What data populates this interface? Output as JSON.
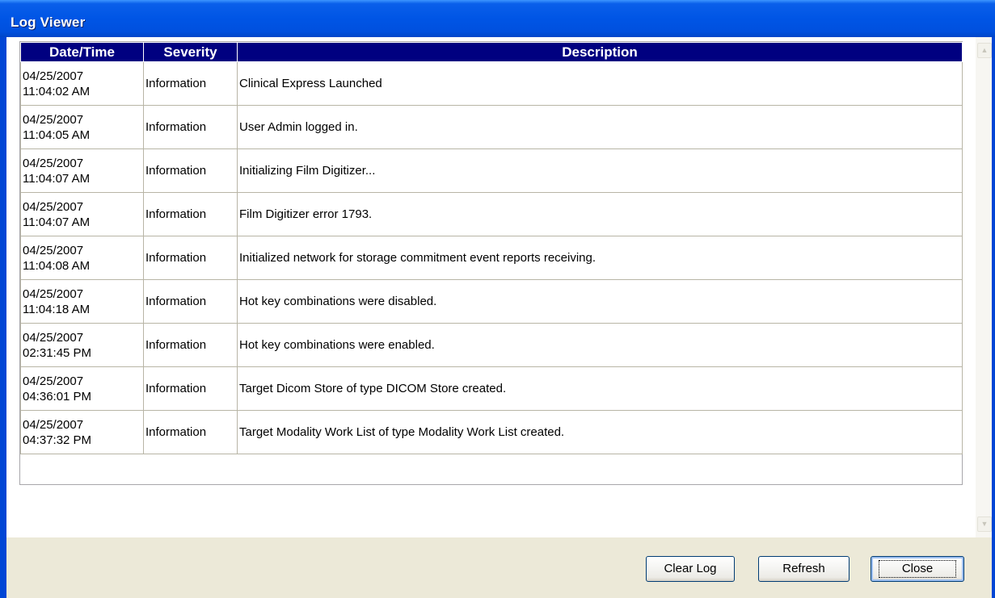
{
  "window": {
    "title": "Log Viewer"
  },
  "columns": [
    "Date/Time",
    "Severity",
    "Description"
  ],
  "rows": [
    {
      "date": "04/25/2007",
      "time": "11:04:02 AM",
      "severity": "Information",
      "description": "Clinical Express Launched"
    },
    {
      "date": "04/25/2007",
      "time": "11:04:05 AM",
      "severity": "Information",
      "description": "User Admin logged in."
    },
    {
      "date": "04/25/2007",
      "time": "11:04:07 AM",
      "severity": "Information",
      "description": "Initializing Film Digitizer..."
    },
    {
      "date": "04/25/2007",
      "time": "11:04:07 AM",
      "severity": "Information",
      "description": "Film Digitizer error 1793."
    },
    {
      "date": "04/25/2007",
      "time": "11:04:08 AM",
      "severity": "Information",
      "description": "Initialized network for storage commitment event reports receiving."
    },
    {
      "date": "04/25/2007",
      "time": "11:04:18 AM",
      "severity": "Information",
      "description": "Hot key combinations were disabled."
    },
    {
      "date": "04/25/2007",
      "time": "02:31:45 PM",
      "severity": "Information",
      "description": "Hot key combinations were enabled."
    },
    {
      "date": "04/25/2007",
      "time": "04:36:01 PM",
      "severity": "Information",
      "description": "Target Dicom Store of type DICOM Store created."
    },
    {
      "date": "04/25/2007",
      "time": "04:37:32 PM",
      "severity": "Information",
      "description": "Target Modality Work List of type Modality Work List created."
    }
  ],
  "buttons": {
    "clear": "Clear Log",
    "refresh": "Refresh",
    "close": "Close"
  },
  "icons": {
    "scroll_up": "chevron-up-icon",
    "scroll_down": "chevron-down-icon"
  },
  "colors": {
    "titlebar": "#0055E5",
    "header_bg": "#000080",
    "face": "#ECE9D8"
  }
}
